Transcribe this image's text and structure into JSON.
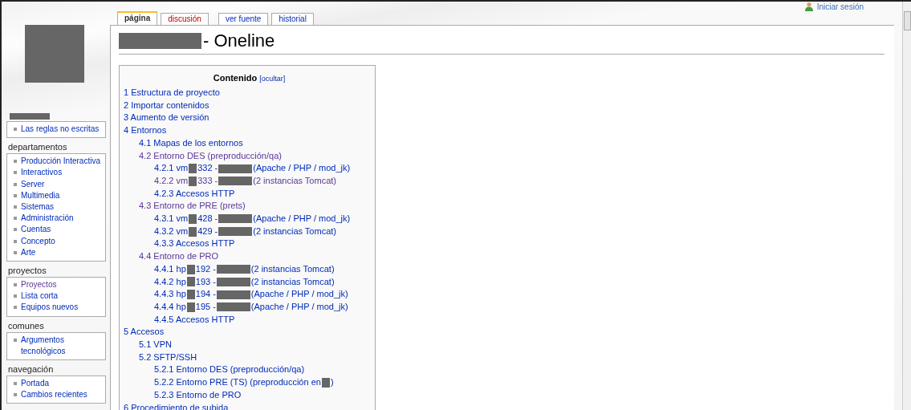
{
  "personal": {
    "login": "Iniciar sesión"
  },
  "tab_groups": [
    [
      {
        "label": "página",
        "selected": true,
        "new_page": false
      },
      {
        "label": "discusión",
        "selected": false,
        "new_page": true
      }
    ],
    [
      {
        "label": "ver fuente",
        "selected": false,
        "new_page": false
      },
      {
        "label": "historial",
        "selected": false,
        "new_page": false
      }
    ]
  ],
  "sidebar": [
    {
      "items": [
        {
          "label": "Las reglas no escritas",
          "visited": false
        }
      ]
    },
    {
      "heading": "departamentos",
      "items": [
        {
          "label": "Producción Interactiva",
          "visited": false
        },
        {
          "label": "Interactivos",
          "visited": false
        },
        {
          "label": "Server",
          "visited": false
        },
        {
          "label": "Multimedia",
          "visited": false
        },
        {
          "label": "Sistemas",
          "visited": false
        },
        {
          "label": "Administración",
          "visited": false
        },
        {
          "label": "Cuentas",
          "visited": false
        },
        {
          "label": "Concepto",
          "visited": false
        },
        {
          "label": "Arte",
          "visited": false
        }
      ]
    },
    {
      "heading": "proyectos",
      "items": [
        {
          "label": "Proyectos",
          "visited": true
        },
        {
          "label": "Lista corta",
          "visited": false
        },
        {
          "label": "Equipos nuevos",
          "visited": false
        }
      ]
    },
    {
      "heading": "comunes",
      "items": [
        {
          "label": "Argumentos tecnológicos",
          "visited": false
        }
      ]
    },
    {
      "heading": "navegación",
      "items": [
        {
          "label": "Portada",
          "visited": false
        },
        {
          "label": "Cambios recientes",
          "visited": false
        }
      ]
    }
  ],
  "page": {
    "title": "- Oneline"
  },
  "toc": {
    "title": "Contenido",
    "toggle": "[ocultar]",
    "entries": [
      {
        "segments": [
          "1 Estructura de proyecto"
        ],
        "visited": false
      },
      {
        "segments": [
          "2 Importar contenidos"
        ],
        "visited": false
      },
      {
        "segments": [
          "3 Aumento de versión"
        ],
        "visited": false
      },
      {
        "segments": [
          "4 Entornos"
        ],
        "visited": false,
        "children": [
          {
            "segments": [
              "4.1 Mapas de los entornos"
            ],
            "visited": false
          },
          {
            "segments": [
              "4.2 Entorno DES (preproducción/qa)"
            ],
            "visited": true,
            "children": [
              {
                "segments": [
                  "4.2.1 vm",
                  "332 -",
                  "(Apache / PHP / mod_jk)"
                ],
                "visited": false
              },
              {
                "segments": [
                  "4.2.2 vm",
                  "333 -",
                  "(2 instancias Tomcat)"
                ],
                "visited": true
              },
              {
                "segments": [
                  "4.2.3 Accesos HTTP"
                ],
                "visited": false
              }
            ]
          },
          {
            "segments": [
              "4.3 Entorno de PRE (prets)"
            ],
            "visited": true,
            "children": [
              {
                "segments": [
                  "4.3.1 vm",
                  "428 -",
                  "(Apache / PHP / mod_jk)"
                ],
                "visited": false
              },
              {
                "segments": [
                  "4.3.2 vm",
                  "429 -",
                  "(2 instancias Tomcat)"
                ],
                "visited": false
              },
              {
                "segments": [
                  "4.3.3 Accesos HTTP"
                ],
                "visited": false
              }
            ]
          },
          {
            "segments": [
              "4.4 Entorno de PRO"
            ],
            "visited": true,
            "children": [
              {
                "segments": [
                  "4.4.1 hp",
                  "192 -",
                  "(2 instancias Tomcat)"
                ],
                "visited": false
              },
              {
                "segments": [
                  "4.4.2 hp",
                  "193 -",
                  "(2 instancias Tomcat)"
                ],
                "visited": false
              },
              {
                "segments": [
                  "4.4.3 hp",
                  "194 -",
                  "(Apache / PHP / mod_jk)"
                ],
                "visited": false
              },
              {
                "segments": [
                  "4.4.4 hp",
                  "195 -",
                  "(Apache / PHP / mod_jk)"
                ],
                "visited": false
              },
              {
                "segments": [
                  "4.4.5 Accesos HTTP"
                ],
                "visited": false
              }
            ]
          }
        ]
      },
      {
        "segments": [
          "5 Accesos"
        ],
        "visited": false,
        "children": [
          {
            "segments": [
              "5.1 VPN"
            ],
            "visited": false
          },
          {
            "segments": [
              "5.2 SFTP/SSH"
            ],
            "visited": false,
            "children": [
              {
                "segments": [
                  "5.2.1 Entorno DES (preproducción/qa)"
                ],
                "visited": false
              },
              {
                "segments": [
                  "5.2.2 Entorno PRE (TS) (preproducción en",
                  ")"
                ],
                "visited": false
              },
              {
                "segments": [
                  "5.2.3 Entorno de PRO"
                ],
                "visited": false
              }
            ]
          }
        ]
      },
      {
        "segments": [
          "6 Procedimiento de subida"
        ],
        "visited": false
      }
    ]
  }
}
